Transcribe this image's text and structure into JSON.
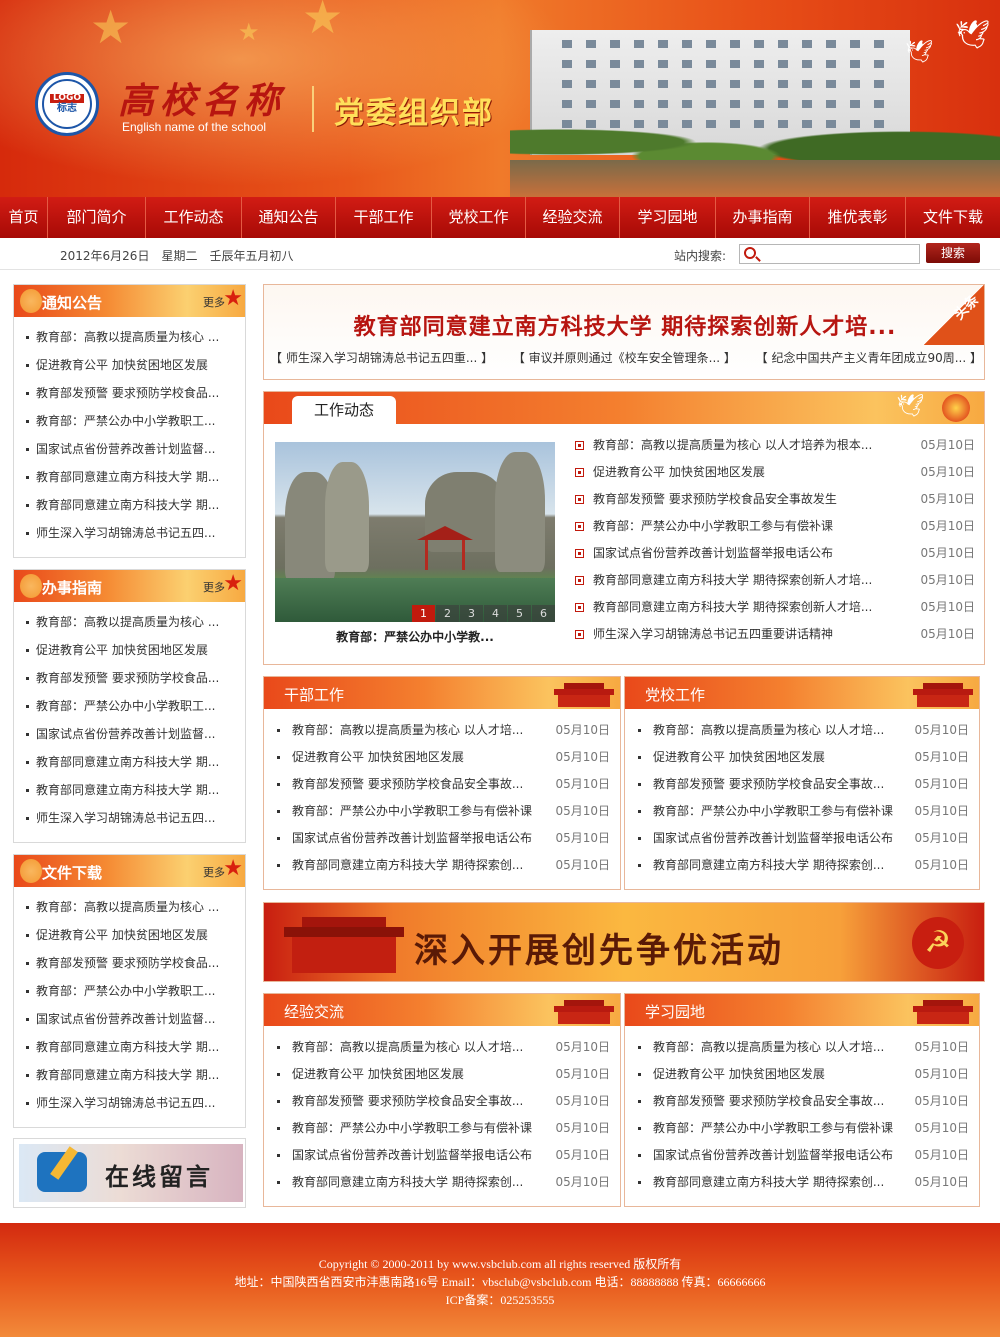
{
  "header": {
    "logo_word": "LOGO",
    "logo_sub": "标志",
    "school_name": "高校名称",
    "school_en": "English name of the school",
    "dept_name": "党委组织部"
  },
  "nav": [
    "首页",
    "部门简介",
    "工作动态",
    "通知公告",
    "干部工作",
    "党校工作",
    "经验交流",
    "学习园地",
    "办事指南",
    "推优表彰",
    "文件下载"
  ],
  "subbar": {
    "date": "2012年6月26日　星期二　壬辰年五月初八",
    "search_label": "站内搜索:",
    "search_button": "搜索"
  },
  "sidebar": [
    {
      "title": "通知公告",
      "more": "更多",
      "items": [
        "教育部：高教以提高质量为核心 ...",
        "促进教育公平 加快贫困地区发展",
        "教育部发预警 要求预防学校食品...",
        "教育部：严禁公办中小学教职工...",
        "国家试点省份营养改善计划监督...",
        "教育部同意建立南方科技大学 期...",
        "教育部同意建立南方科技大学 期...",
        "师生深入学习胡锦涛总书记五四..."
      ]
    },
    {
      "title": "办事指南",
      "more": "更多",
      "items": [
        "教育部：高教以提高质量为核心 ...",
        "促进教育公平 加快贫困地区发展",
        "教育部发预警 要求预防学校食品...",
        "教育部：严禁公办中小学教职工...",
        "国家试点省份营养改善计划监督...",
        "教育部同意建立南方科技大学 期...",
        "教育部同意建立南方科技大学 期...",
        "师生深入学习胡锦涛总书记五四..."
      ]
    },
    {
      "title": "文件下载",
      "more": "更多",
      "items": [
        "教育部：高教以提高质量为核心 ...",
        "促进教育公平 加快贫困地区发展",
        "教育部发预警 要求预防学校食品...",
        "教育部：严禁公办中小学教职工...",
        "国家试点省份营养改善计划监督...",
        "教育部同意建立南方科技大学 期...",
        "教育部同意建立南方科技大学 期...",
        "师生深入学习胡锦涛总书记五四..."
      ]
    }
  ],
  "online_message": "在线留言",
  "headline": {
    "tag": "头条",
    "title": "教育部同意建立南方科技大学 期待探索创新人才培...",
    "subs": [
      "【 师生深入学习胡锦涛总书记五四重... 】",
      "【 审议并原则通过《校车安全管理条... 】",
      "【 纪念中国共产主义青年团成立90周... 】"
    ]
  },
  "work": {
    "title": "工作动态",
    "photo_caption": "教育部：严禁公办中小学教...",
    "photo_pages": [
      "1",
      "2",
      "3",
      "4",
      "5",
      "6"
    ],
    "items": [
      {
        "t": "教育部：高教以提高质量为核心 以人才培养为根本...",
        "d": "05月10日"
      },
      {
        "t": "促进教育公平 加快贫困地区发展",
        "d": "05月10日"
      },
      {
        "t": "教育部发预警 要求预防学校食品安全事故发生",
        "d": "05月10日"
      },
      {
        "t": "教育部：严禁公办中小学教职工参与有偿补课",
        "d": "05月10日"
      },
      {
        "t": "国家试点省份营养改善计划监督举报电话公布",
        "d": "05月10日"
      },
      {
        "t": "教育部同意建立南方科技大学 期待探索创新人才培...",
        "d": "05月10日"
      },
      {
        "t": "教育部同意建立南方科技大学 期待探索创新人才培...",
        "d": "05月10日"
      },
      {
        "t": "师生深入学习胡锦涛总书记五四重要讲话精神",
        "d": "05月10日"
      }
    ]
  },
  "panels": [
    {
      "title": "干部工作",
      "items": [
        {
          "t": "教育部：高教以提高质量为核心 以人才培...",
          "d": "05月10日"
        },
        {
          "t": "促进教育公平 加快贫困地区发展",
          "d": "05月10日"
        },
        {
          "t": "教育部发预警 要求预防学校食品安全事故...",
          "d": "05月10日"
        },
        {
          "t": "教育部：严禁公办中小学教职工参与有偿补课",
          "d": "05月10日"
        },
        {
          "t": "国家试点省份营养改善计划监督举报电话公布",
          "d": "05月10日"
        },
        {
          "t": "教育部同意建立南方科技大学 期待探索创...",
          "d": "05月10日"
        }
      ]
    },
    {
      "title": "党校工作",
      "items": [
        {
          "t": "教育部：高教以提高质量为核心 以人才培...",
          "d": "05月10日"
        },
        {
          "t": "促进教育公平 加快贫困地区发展",
          "d": "05月10日"
        },
        {
          "t": "教育部发预警 要求预防学校食品安全事故...",
          "d": "05月10日"
        },
        {
          "t": "教育部：严禁公办中小学教职工参与有偿补课",
          "d": "05月10日"
        },
        {
          "t": "国家试点省份营养改善计划监督举报电话公布",
          "d": "05月10日"
        },
        {
          "t": "教育部同意建立南方科技大学 期待探索创...",
          "d": "05月10日"
        }
      ]
    },
    {
      "title": "经验交流",
      "items": [
        {
          "t": "教育部：高教以提高质量为核心 以人才培...",
          "d": "05月10日"
        },
        {
          "t": "促进教育公平 加快贫困地区发展",
          "d": "05月10日"
        },
        {
          "t": "教育部发预警 要求预防学校食品安全事故...",
          "d": "05月10日"
        },
        {
          "t": "教育部：严禁公办中小学教职工参与有偿补课",
          "d": "05月10日"
        },
        {
          "t": "国家试点省份营养改善计划监督举报电话公布",
          "d": "05月10日"
        },
        {
          "t": "教育部同意建立南方科技大学 期待探索创...",
          "d": "05月10日"
        }
      ]
    },
    {
      "title": "学习园地",
      "items": [
        {
          "t": "教育部：高教以提高质量为核心 以人才培...",
          "d": "05月10日"
        },
        {
          "t": "促进教育公平 加快贫困地区发展",
          "d": "05月10日"
        },
        {
          "t": "教育部发预警 要求预防学校食品安全事故...",
          "d": "05月10日"
        },
        {
          "t": "教育部：严禁公办中小学教职工参与有偿补课",
          "d": "05月10日"
        },
        {
          "t": "国家试点省份营养改善计划监督举报电话公布",
          "d": "05月10日"
        },
        {
          "t": "教育部同意建立南方科技大学 期待探索创...",
          "d": "05月10日"
        }
      ]
    }
  ],
  "banner": "深入开展创先争优活动",
  "footer": {
    "line1": "Copyright © 2000-2011 by www.vsbclub.com all rights reserved 版权所有",
    "line2": "地址：中国陕西省西安市沣惠南路16号 Email：vbsclub@vsbclub.com 电话：88888888 传真：66666666",
    "line3": "ICP备案：025253555"
  },
  "colors": {
    "brand_red": "#c11a0d",
    "accent_orange": "#f07a2a",
    "gold": "#ffe05a"
  }
}
